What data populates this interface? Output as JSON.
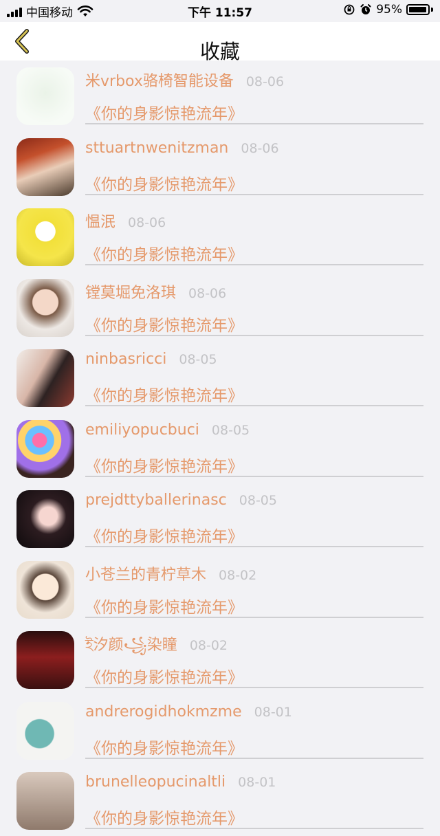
{
  "status_bar": {
    "carrier": "中国移动",
    "time": "下午 11:57",
    "battery": "95%",
    "battery_level": 0.95
  },
  "nav": {
    "title": "收藏",
    "back_icon": "chevron-left-icon"
  },
  "colors": {
    "accent": "#e5996b",
    "date": "#c3c3c6"
  },
  "items": [
    {
      "name": "米vrbox骆椅智能设备",
      "date": "08-06",
      "work": "《你的身影惊艳流年》"
    },
    {
      "name": "sttuartnwenitzman",
      "date": "08-06",
      "work": "《你的身影惊艳流年》"
    },
    {
      "name": "愠泯",
      "date": "08-06",
      "work": "《你的身影惊艳流年》"
    },
    {
      "name": "镗莫堀免洛琪",
      "date": "08-06",
      "work": "《你的身影惊艳流年》"
    },
    {
      "name": "ninbasricci",
      "date": "08-05",
      "work": "《你的身影惊艳流年》"
    },
    {
      "name": "emiliyopucbuci",
      "date": "08-05",
      "work": "《你的身影惊艳流年》"
    },
    {
      "name": "prejdttyballerinasc",
      "date": "08-05",
      "work": "《你的身影惊艳流年》"
    },
    {
      "name": "小苍兰的青柠草木",
      "date": "08-02",
      "work": "《你的身影惊艳流年》"
    },
    {
      "name": "ই汐颜꧁染瞳",
      "date": "08-02",
      "work": "《你的身影惊艳流年》"
    },
    {
      "name": "andrerogidhokmzme",
      "date": "08-01",
      "work": "《你的身影惊艳流年》"
    },
    {
      "name": "brunelleopucinaltli",
      "date": "08-01",
      "work": "《你的身影惊艳流年》"
    }
  ]
}
